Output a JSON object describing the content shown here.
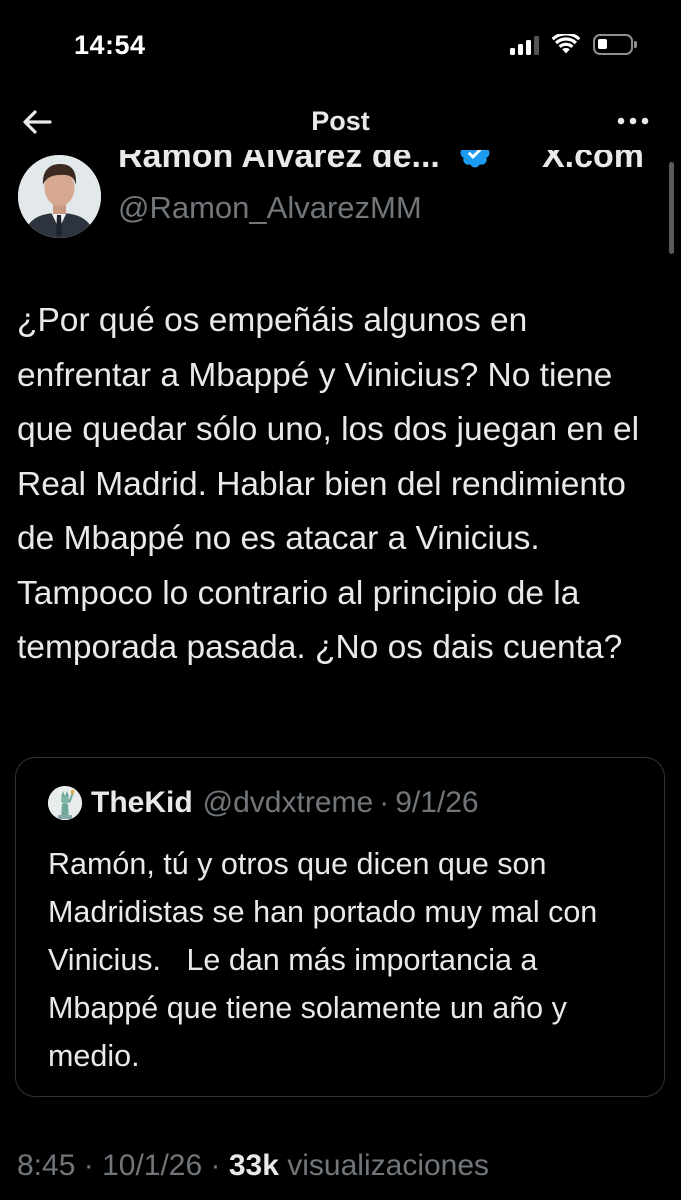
{
  "status_bar": {
    "time": "14:54"
  },
  "nav": {
    "title": "Post"
  },
  "author": {
    "name": "Ramon Alvarez de...",
    "handle": "@Ramon_AlvarezMM",
    "source": "X.com",
    "verified_color": "#1d9bf0"
  },
  "post": {
    "text": "¿Por qué os empeñáis algunos en enfrentar a Mbappé y Vinicius? No tiene que quedar sólo uno, los dos juegan en el Real Madrid. Hablar bien del rendimiento de Mbappé no es atacar a Vinicius. Tampoco lo contrario al principio de la temporada pasada. ¿No os dais cuenta?"
  },
  "quoted_post": {
    "name": "TheKid",
    "handle": "@dvdxtreme",
    "separator": "·",
    "date": "9/1/26",
    "text": "Ramón, tú y otros que dicen que son Madridistas se han portado muy mal con Vinicius.   Le dan más importancia a Mbappé que tiene solamente un año y medio."
  },
  "meta": {
    "time": "8:45",
    "separator": "·",
    "date": "10/1/26",
    "views_count": "33k",
    "views_label": "visualizaciones"
  },
  "colors": {
    "background": "#000000",
    "text": "#e7e9ea",
    "secondary": "#71767b",
    "border": "#2f3336",
    "accent": "#1d9bf0"
  },
  "icons": {
    "back": "arrow-left-icon",
    "more": "ellipsis-icon",
    "verified": "verified-badge-icon",
    "signal": "cellular-signal-icon",
    "wifi": "wifi-icon",
    "battery": "battery-icon"
  }
}
